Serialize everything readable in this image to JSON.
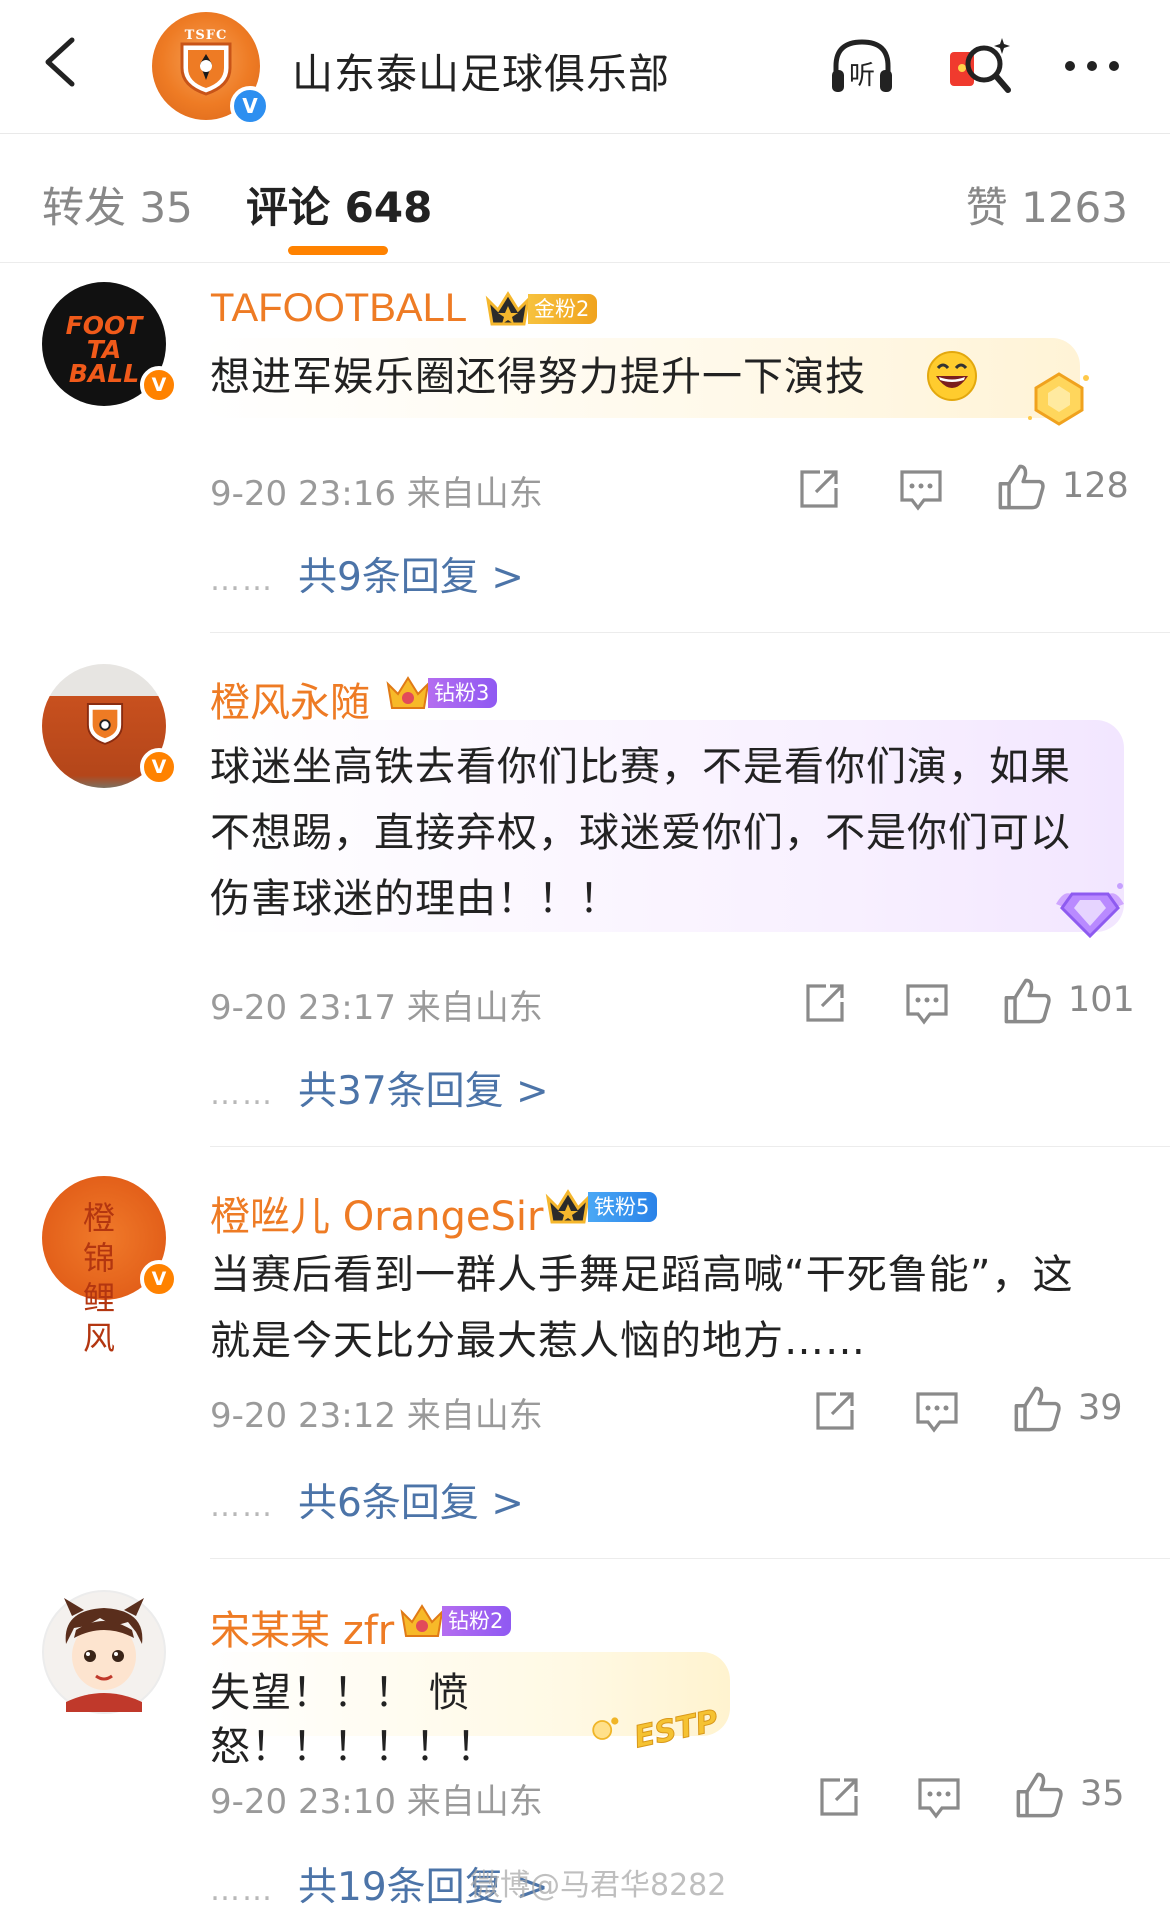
{
  "header": {
    "title": "山东泰山足球俱乐部",
    "club_logo_text": "TSFC",
    "verify_mark": "V",
    "accent_color": "#ff8200"
  },
  "tabs": {
    "repost": "转发 35",
    "comments": "评论 648",
    "likes": "赞 1263"
  },
  "comments": [
    {
      "user": "TAFOOTBALL",
      "avatar_text": "FOOT TA BALL",
      "fan_badge": "金粉2",
      "text": "想进军娱乐圈还得努力提升一下演技",
      "meta": "9-20 23:16 来自山东",
      "likes": "128",
      "replies": "共9条回复 >"
    },
    {
      "user": "橙风永随",
      "avatar_text": "TSFC",
      "fan_badge": "钻粉3",
      "text": "球迷坐高铁去看你们比赛，不是看你们演，如果不想踢，直接弃权，球迷爱你们，不是你们可以伤害球迷的理由！！！",
      "meta": "9-20 23:17 来自山东",
      "likes": "101",
      "replies": "共37条回复 >"
    },
    {
      "user": "橙咝儿 OrangeSir",
      "avatar_text": "橙 锦 鲤 风",
      "fan_badge": "铁粉5",
      "text": "当赛后看到一群人手舞足蹈高喊“干死鲁能”，这就是今天比分最大惹人恼的地方……",
      "meta": "9-20 23:12 来自山东",
      "likes": "39",
      "replies": "共6条回复 >"
    },
    {
      "user": "宋某某 zfr",
      "fan_badge": "钻粉2",
      "text": "失望！！！ 愤怒！！！！！！",
      "bubble_sticker": "ESTP",
      "meta": "9-20 23:10 来自山东",
      "likes": "35",
      "replies": "共19条回复 >"
    }
  ],
  "reply_dots": "……",
  "watermark": "微博@马君华8282"
}
